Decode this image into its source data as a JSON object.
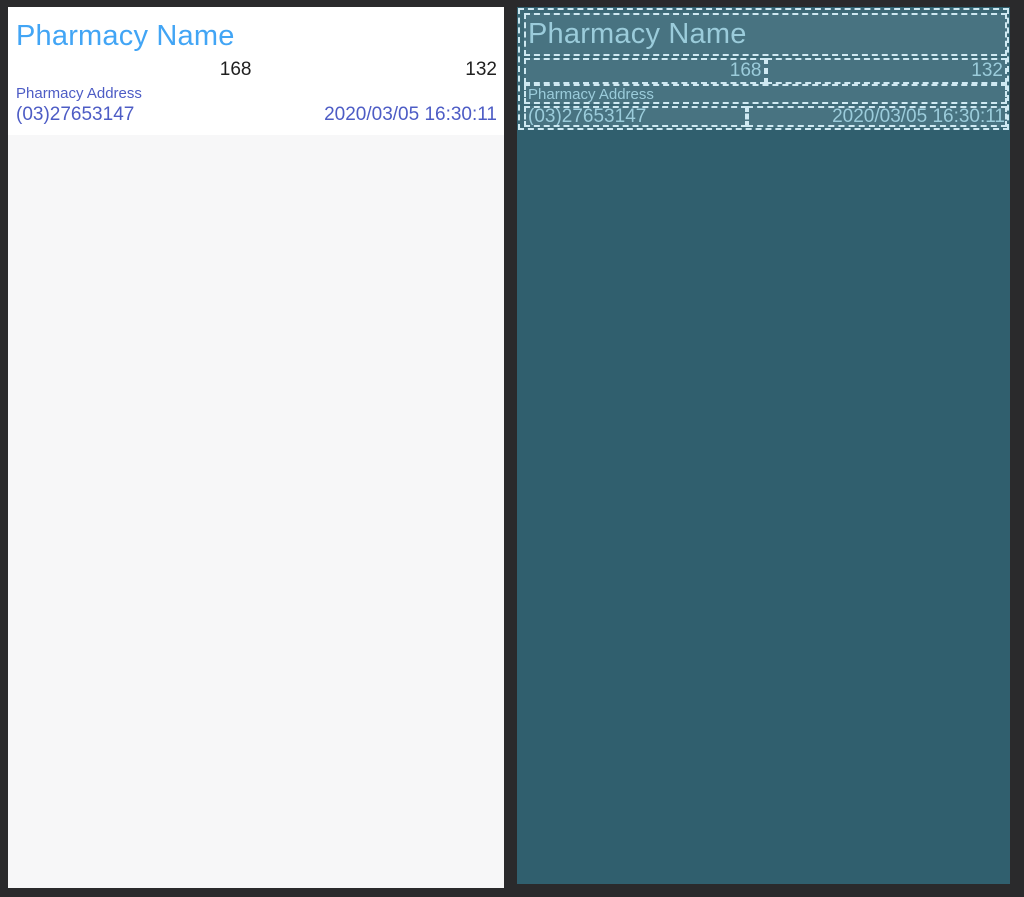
{
  "app": {
    "title": "Pharmacy Name",
    "counter_left": "168",
    "counter_right": "132",
    "address": "Pharmacy Address",
    "phone": "(03)27653147",
    "timestamp": "2020/03/05 16:30:11"
  },
  "colors": {
    "title_blue": "#42a5f5",
    "counter_text": "#1f1f1f",
    "info_indigo": "#4d5cc5",
    "frame_dark": "#2a2a2c",
    "header_white": "#ffffff",
    "app_body_gray": "#f7f7f8",
    "overlay_bg_teal": "#305f6e",
    "overlay_container_fill": "#3c6977",
    "overlay_box_fill": "#487381",
    "overlay_border": "#cfe9f2",
    "overlay_text": "#9bccdb"
  }
}
